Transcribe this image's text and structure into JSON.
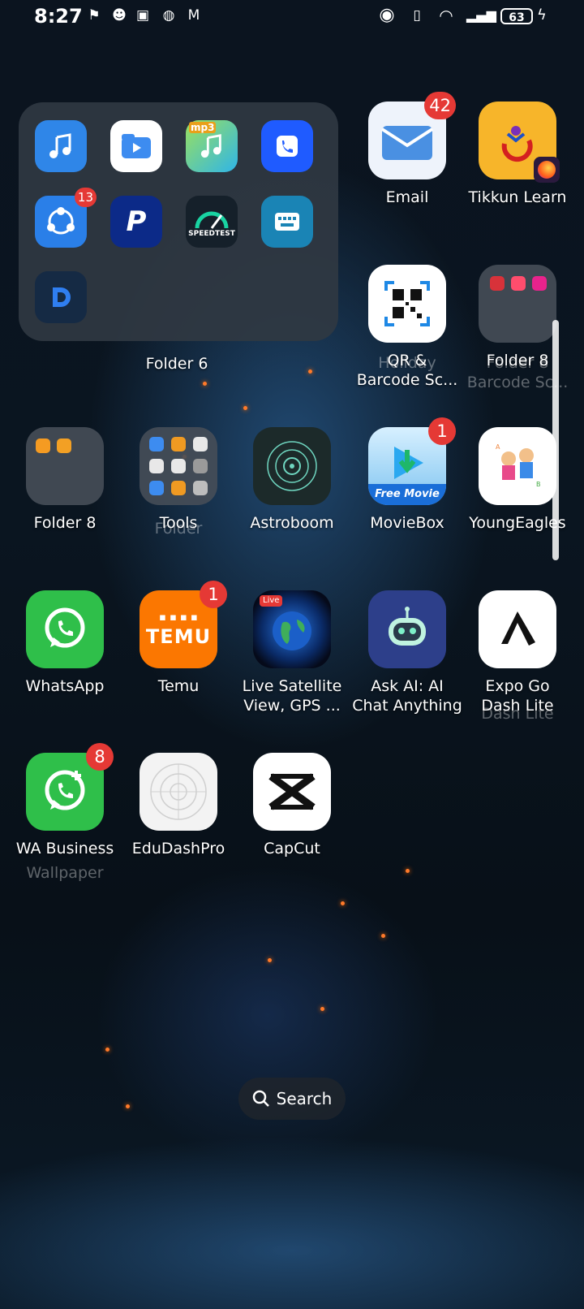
{
  "status_bar": {
    "time": "8:27",
    "battery": "63",
    "left_icons": [
      "flag-icon",
      "face-icon",
      "temu-icon",
      "globe-icon",
      "gmail-icon"
    ],
    "right_icons": [
      "eye-icon",
      "vibrate-icon",
      "wifi-icon",
      "signal-icon"
    ]
  },
  "open_folder": {
    "name": "Folder 6",
    "apps": [
      {
        "icon": "music-icon",
        "color": "#2f86e8"
      },
      {
        "icon": "files-icon",
        "color": "#ffffff"
      },
      {
        "icon": "mp3-icon",
        "color": "#38b6e8"
      },
      {
        "icon": "phone-icon",
        "color": "#1f5bff"
      },
      {
        "icon": "shareit-icon",
        "color": "#2a7fe8",
        "badge": "13"
      },
      {
        "icon": "paypal-icon",
        "color": "#0c2a88"
      },
      {
        "icon": "speedtest-icon",
        "color": "#15202a"
      },
      {
        "icon": "keyboard-icon",
        "color": "#1a84b5"
      },
      {
        "icon": "d-icon",
        "color": "#152a44"
      }
    ]
  },
  "grid_apps": {
    "email": {
      "label": "Email",
      "badge": "42"
    },
    "tikkun": {
      "label": "Tikkun Learn"
    },
    "qr": {
      "label_line1": "QR &",
      "label_line2": "Barcode Sc..."
    },
    "folder8_top": {
      "label": "Folder 8"
    },
    "folder8": {
      "label": "Folder 8"
    },
    "tools": {
      "label": "Tools"
    },
    "astroboom": {
      "label": "Astroboom"
    },
    "moviebox": {
      "label": "MovieBox",
      "badge": "1"
    },
    "youngeagles": {
      "label": "YoungEagles"
    },
    "whatsapp": {
      "label": "WhatsApp"
    },
    "temu": {
      "label": "Temu",
      "badge": "1",
      "icon_text": "TEMU"
    },
    "earth": {
      "label_line1": "Live Satellite",
      "label_line2": "View, GPS ...",
      "live_tag": "Live"
    },
    "askai": {
      "label_line1": "Ask AI: AI",
      "label_line2": "Chat Anything"
    },
    "expogo": {
      "label_line1": "Expo Go",
      "label_line2": "Dash Lite"
    },
    "wabusiness": {
      "label": "WA Business",
      "badge": "8"
    },
    "edudash": {
      "label": "EduDashPro"
    },
    "capcut": {
      "label": "CapCut"
    }
  },
  "moviebox_banner": "Free Movie",
  "speedtest_text": "SPEEDTEST",
  "mp3_text": "mp3",
  "ghost_labels": [
    "Wallpaper",
    "Folder 8",
    "Barcode Sc...",
    "Holiday",
    "Folder",
    "Dash Lite"
  ],
  "search": {
    "label": "Search"
  }
}
